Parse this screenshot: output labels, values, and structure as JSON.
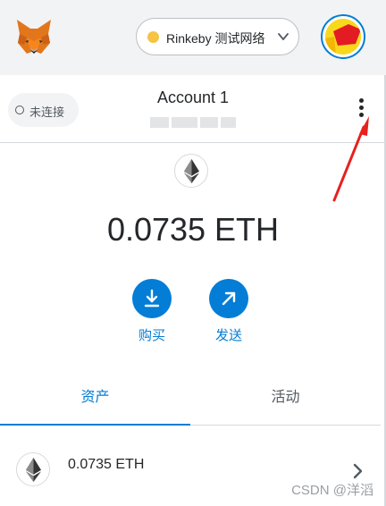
{
  "network": {
    "label": "Rinkeby 测试网络",
    "dot_color": "#f6c343"
  },
  "account": {
    "name": "Account 1",
    "connection_status": "未连接"
  },
  "balance": {
    "amount": "0.0735 ETH"
  },
  "actions": {
    "buy_label": "购买",
    "send_label": "发送"
  },
  "tabs": {
    "assets_label": "资产",
    "activity_label": "活动",
    "active": "assets"
  },
  "assets": [
    {
      "label": "0.0735 ETH",
      "icon": "ethereum-icon"
    }
  ],
  "colors": {
    "accent": "#037dd6",
    "annotation_arrow": "#e8201e",
    "topbar_bg": "#f2f3f4"
  },
  "watermark": "CSDN @洋滔"
}
